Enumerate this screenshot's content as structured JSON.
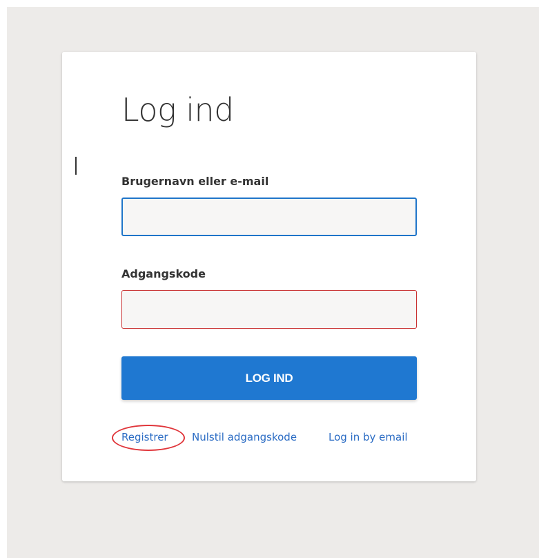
{
  "login_form": {
    "title": "Log ind",
    "username_label": "Brugernavn eller e-mail",
    "username_value": "",
    "password_label": "Adgangskode",
    "password_value": "",
    "submit_label": "LOG IND"
  },
  "links": {
    "register": "Registrer",
    "reset_password": "Nulstil adgangskode",
    "email_login": "Log in by email"
  },
  "colors": {
    "page_background": "#edebe9",
    "card_background": "#ffffff",
    "primary_button": "#1f78d1",
    "focused_border": "#1f75c9",
    "error_border": "#c93131",
    "link": "#2b6cc4",
    "highlight": "#e0363b"
  }
}
